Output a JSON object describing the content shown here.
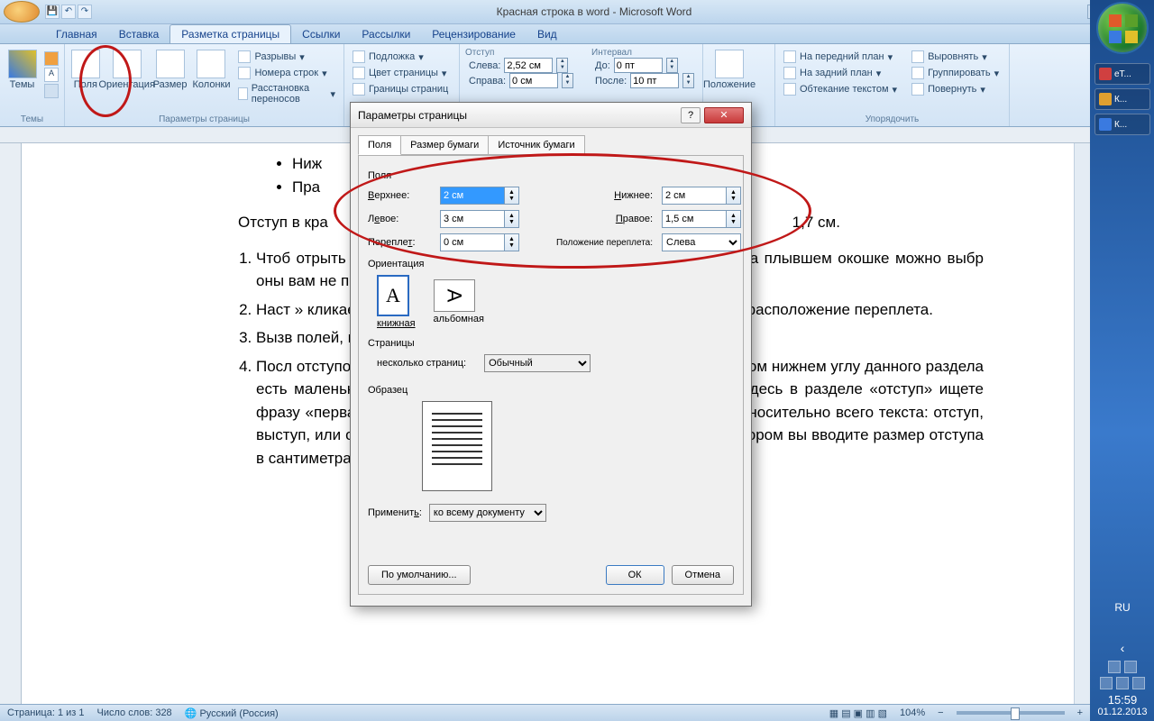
{
  "title": "Красная строка в word - Microsoft Word",
  "qat": {
    "save": "💾",
    "undo": "↶",
    "redo": "↷"
  },
  "tabs": [
    "Главная",
    "Вставка",
    "Разметка страницы",
    "Ссылки",
    "Рассылки",
    "Рецензирование",
    "Вид"
  ],
  "active_tab": 2,
  "ribbon": {
    "themes": {
      "label": "Темы",
      "btn": "Темы"
    },
    "page_setup": {
      "label": "Параметры страницы",
      "margins": "Поля",
      "orientation": "Ориентация",
      "size": "Размер",
      "columns": "Колонки",
      "breaks": "Разрывы",
      "line_numbers": "Номера строк",
      "hyphenation": "Расстановка переносов"
    },
    "page_bg": {
      "label": "",
      "watermark": "Подложка",
      "color": "Цвет страницы",
      "borders": "Границы страниц"
    },
    "paragraph": {
      "label": "",
      "indent_title": "Отступ",
      "left_label": "Слева:",
      "left_val": "2,52 см",
      "right_label": "Справа:",
      "right_val": "0 см",
      "spacing_title": "Интервал",
      "before_label": "До:",
      "before_val": "0 пт",
      "after_label": "После:",
      "after_val": "10 пт"
    },
    "position": {
      "label": "",
      "btn": "Положение"
    },
    "arrange": {
      "label": "Упорядочить",
      "front": "На передний план",
      "back": "На задний план",
      "wrap": "Обтекание текстом",
      "align": "Выровнять",
      "group": "Группировать",
      "rotate": "Повернуть"
    }
  },
  "document": {
    "bul1": "Ниж",
    "bul2": "Пра",
    "p1_a": "Отступ в кра",
    "p1_b": "1,7 см.",
    "li1": "Чтоб                                                                                     отрыть вкладку «Разметка стра                                                                                    ите в раздел «Параметры стра                                                                                      плывшем окошке можно выбр                                                                                       оны вам не подходят, то мож",
    "li2": "Наст                                                                                         » кликаете иконку «поля», дале                                                                                       вшемся диалоговом окне ввод                                                                                       расположение переплета.",
    "li3": "Вызв                                                                                        полей, можно нажав на мале                                                                                          раметры страницы».",
    "li4": "Посл                                                                                   отступов от края страницы мож                                                                                   оки. Заходите на вкладку «Раз                                                                                    ом нижнем углу данного раздела есть маленькая стрелочка. Кликаете по ней. Всплывает окошко. Здесь в разделе «отступ» ищете фразу «первая строка». Здесь можно выбрать положение строки относительно всего текста: отступ, выступ, или отсутствие изменений. Далее справа есть окошко, в котором вы вводите размер отступа в сантиметрах."
  },
  "dialog": {
    "title": "Параметры страницы",
    "tabs": [
      "Поля",
      "Размер бумаги",
      "Источник бумаги"
    ],
    "active_tab": 0,
    "section_fields": "Поля",
    "top": {
      "label": "Верхнее:",
      "val": "2 см"
    },
    "bottom": {
      "label": "Нижнее:",
      "val": "2 см"
    },
    "left": {
      "label": "Левое:",
      "val": "3 см"
    },
    "right": {
      "label": "Правое:",
      "val": "1,5 см"
    },
    "gutter": {
      "label": "Переплет:",
      "val": "0 см"
    },
    "gutter_pos": {
      "label": "Положение переплета:",
      "val": "Слева"
    },
    "section_orient": "Ориентация",
    "portrait": "книжная",
    "landscape": "альбомная",
    "section_pages": "Страницы",
    "multi_pages_label": "несколько страниц:",
    "multi_pages_val": "Обычный",
    "section_preview": "Образец",
    "apply_label": "Применить:",
    "apply_val": "ко всему документу",
    "default_btn": "По умолчанию...",
    "ok": "ОК",
    "cancel": "Отмена"
  },
  "status": {
    "page": "Страница: 1 из 1",
    "words": "Число слов: 328",
    "lang": "Русский (Россия)",
    "zoom": "104%"
  },
  "taskbar": {
    "lang": "RU",
    "time": "15:59",
    "date": "01.12.2013",
    "app1": "еТ...",
    "app2": "К...",
    "app3": "К..."
  }
}
